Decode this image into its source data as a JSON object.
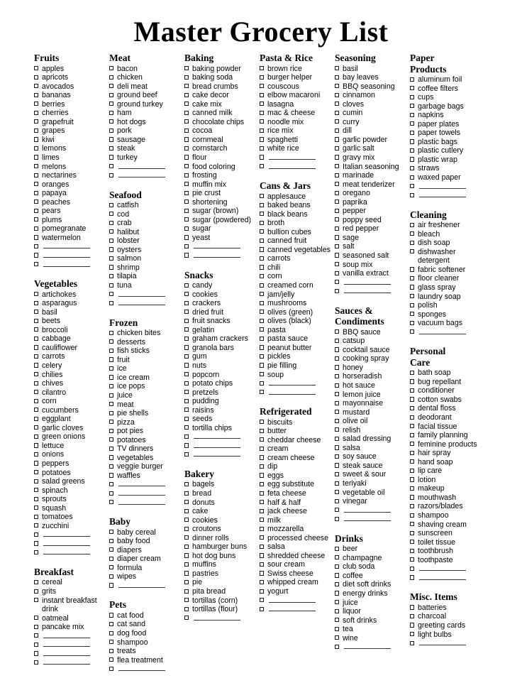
{
  "title": "Master Grocery List",
  "checkbox_icon": "empty-checkbox",
  "blank_line_icon": "write-in-rule",
  "colors": {
    "text": "#000000",
    "background": "#ffffff",
    "checkbox_border": "#1a1a1a",
    "rule": "#333333"
  },
  "columns": [
    {
      "sections": [
        {
          "title": "Fruits",
          "items": [
            "apples",
            "apricots",
            "avocados",
            "bananas",
            "berries",
            "cherries",
            "grapefruit",
            "grapes",
            "kiwi",
            "lemons",
            "limes",
            "melons",
            "nectarines",
            "oranges",
            "papaya",
            "peaches",
            "pears",
            "plums",
            "pomegranate",
            "watermelon"
          ],
          "blanks": 3
        },
        {
          "title": "Vegetables",
          "items": [
            "artichokes",
            "asparagus",
            "basil",
            "beets",
            "broccoli",
            "cabbage",
            "cauliflower",
            "carrots",
            "celery",
            "chilies",
            "chives",
            "cilantro",
            "corn",
            "cucumbers",
            "eggplant",
            "garlic cloves",
            "green onions",
            "lettuce",
            "onions",
            "peppers",
            "potatoes",
            "salad greens",
            "spinach",
            "sprouts",
            "squash",
            "tomatoes",
            "zucchini"
          ],
          "blanks": 3
        },
        {
          "title": "Breakfast",
          "items": [
            "cereal",
            "grits",
            "instant breakfast drink",
            "oatmeal",
            "pancake mix"
          ],
          "blanks": 4
        }
      ]
    },
    {
      "sections": [
        {
          "title": "Meat",
          "items": [
            "bacon",
            "chicken",
            "deli meat",
            "ground beef",
            "ground turkey",
            "ham",
            "hot dogs",
            "pork",
            "sausage",
            "steak",
            "turkey"
          ],
          "blanks": 2
        },
        {
          "title": "Seafood",
          "items": [
            "catfish",
            "cod",
            "crab",
            "halibut",
            "lobster",
            "oysters",
            "salmon",
            "shrimp",
            "tilapia",
            "tuna"
          ],
          "blanks": 2
        },
        {
          "title": "Frozen",
          "items": [
            "chicken bites",
            "desserts",
            "fish sticks",
            "fruit",
            "ice",
            "ice cream",
            "ice pops",
            "juice",
            "meat",
            "pie shells",
            "pizza",
            "pot pies",
            "potatoes",
            "TV dinners",
            "vegetables",
            "veggie burger",
            "waffles"
          ],
          "blanks": 3
        },
        {
          "title": "Baby",
          "items": [
            "baby cereal",
            "baby food",
            "diapers",
            "diaper cream",
            "formula",
            "wipes"
          ],
          "blanks": 1
        },
        {
          "title": "Pets",
          "items": [
            "cat food",
            "cat sand",
            "dog food",
            "shampoo",
            "treats",
            "flea treatment"
          ],
          "blanks": 1
        }
      ]
    },
    {
      "sections": [
        {
          "title": "Baking",
          "items": [
            "baking powder",
            "baking soda",
            "bread crumbs",
            "cake decor",
            "cake mix",
            "canned milk",
            "chocolate chips",
            "cocoa",
            "cornmeal",
            "cornstarch",
            "flour",
            "food coloring",
            "frosting",
            "muffin mix",
            "pie crust",
            "shortening",
            "sugar (brown)",
            "sugar (powdered)",
            "sugar",
            "yeast"
          ],
          "blanks": 2
        },
        {
          "title": "Snacks",
          "items": [
            "candy",
            "cookies",
            "crackers",
            "dried fruit",
            "fruit snacks",
            "gelatin",
            "graham crackers",
            "granola bars",
            "gum",
            "nuts",
            "popcorn",
            "potato chips",
            "pretzels",
            "pudding",
            "raisins",
            "seeds",
            "tortilla chips"
          ],
          "blanks": 3
        },
        {
          "title": "Bakery",
          "items": [
            "bagels",
            "bread",
            "donuts",
            "cake",
            "cookies",
            "croutons",
            "dinner rolls",
            "hamburger buns",
            "hot dog buns",
            "muffins",
            "pastries",
            "pie",
            "pita bread",
            "tortillas (corn)",
            "tortillas (flour)"
          ],
          "blanks": 1
        }
      ]
    },
    {
      "sections": [
        {
          "title": "Pasta & Rice",
          "items": [
            "brown rice",
            "burger helper",
            "couscous",
            "elbow macaroni",
            "lasagna",
            "mac & cheese",
            "noodle mix",
            "rice mix",
            "spaghetti",
            "white rice"
          ],
          "blanks": 2
        },
        {
          "title": "Cans & Jars",
          "items": [
            "applesauce",
            "baked beans",
            "black beans",
            "broth",
            "bullion cubes",
            "canned fruit",
            "canned vegetables",
            "carrots",
            "chili",
            "corn",
            "creamed corn",
            "jam/jelly",
            "mushrooms",
            "olives (green)",
            "olives (black)",
            "pasta",
            "pasta sauce",
            "peanut butter",
            "pickles",
            "pie filling",
            "soup"
          ],
          "blanks": 2
        },
        {
          "title": "Refrigerated",
          "items": [
            "biscuits",
            "butter",
            "cheddar cheese",
            "cream",
            "cream cheese",
            "dip",
            "eggs",
            "egg substitute",
            "feta cheese",
            "half & half",
            "jack cheese",
            "milk",
            "mozzarella",
            "processed cheese",
            "salsa",
            "shredded cheese",
            "sour cream",
            "Swiss cheese",
            "whipped cream",
            "yogurt"
          ],
          "blanks": 2
        }
      ]
    },
    {
      "sections": [
        {
          "title": "Seasoning",
          "items": [
            "basil",
            "bay leaves",
            "BBQ seasoning",
            "cinnamon",
            "cloves",
            "cumin",
            "curry",
            "dill",
            "garlic powder",
            "garlic salt",
            "gravy mix",
            "Italian seasoning",
            "marinade",
            "meat tenderizer",
            "oregano",
            "paprika",
            "pepper",
            "poppy seed",
            "red pepper",
            "sage",
            "salt",
            "seasoned salt",
            "soup mix",
            "vanilla extract"
          ],
          "blanks": 2
        },
        {
          "title": "Sauces &\nCondiments",
          "items": [
            "BBQ sauce",
            "catsup",
            "cocktail sauce",
            "cooking spray",
            "honey",
            "horseradish",
            "hot sauce",
            "lemon juice",
            "mayonnaise",
            "mustard",
            "olive oil",
            "relish",
            "salad dressing",
            "salsa",
            "soy sauce",
            "steak sauce",
            "sweet & sour",
            "teriyaki",
            "vegetable oil",
            "vinegar"
          ],
          "blanks": 2
        },
        {
          "title": "Drinks",
          "items": [
            "beer",
            "champagne",
            "club soda",
            "coffee",
            "diet soft drinks",
            "energy drinks",
            "juice",
            "liquor",
            "soft drinks",
            "tea",
            "wine"
          ],
          "blanks": 1
        }
      ]
    },
    {
      "sections": [
        {
          "title": "Paper\nProducts",
          "items": [
            "aluminum foil",
            "coffee filters",
            "cups",
            "garbage bags",
            "napkins",
            "paper plates",
            "paper towels",
            "plastic bags",
            "plastic cutlery",
            "plastic wrap",
            "straws",
            "waxed paper"
          ],
          "blanks": 2
        },
        {
          "title": "Cleaning",
          "items": [
            "air freshener",
            "bleach",
            "dish soap",
            "dishwasher detergent",
            "fabric softener",
            "floor cleaner",
            "glass spray",
            "laundry soap",
            "polish",
            "sponges",
            "vacuum bags"
          ],
          "blanks": 1
        },
        {
          "title": "Personal\nCare",
          "items": [
            "bath soap",
            "bug repellant",
            "conditioner",
            "cotton swabs",
            "dental floss",
            "deodorant",
            "facial tissue",
            "family planning",
            "feminine products",
            "hair spray",
            "hand soap",
            "lip care",
            "lotion",
            "makeup",
            "mouthwash",
            "razors/blades",
            "shampoo",
            "shaving cream",
            "sunscreen",
            "toilet tissue",
            "toothbrush",
            "toothpaste"
          ],
          "blanks": 2
        },
        {
          "title": "Misc. Items",
          "items": [
            "batteries",
            "charcoal",
            "greeting cards",
            "light bulbs"
          ],
          "blanks": 1
        }
      ]
    }
  ]
}
